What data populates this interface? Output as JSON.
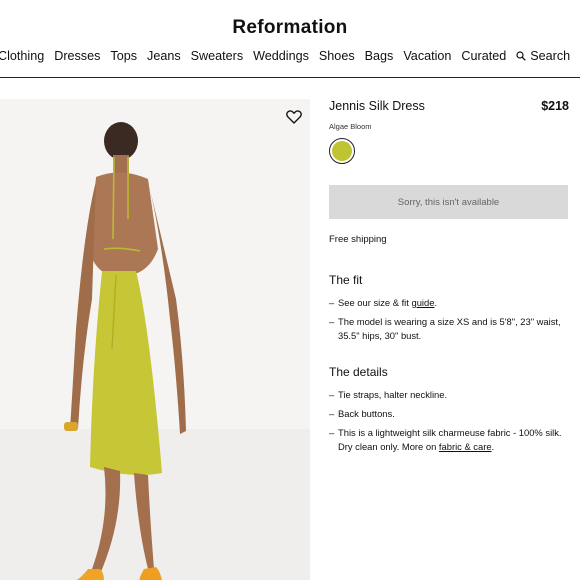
{
  "header": {
    "logo": "Reformation",
    "nav": [
      "Clothing",
      "Dresses",
      "Tops",
      "Jeans",
      "Sweaters",
      "Weddings",
      "Shoes",
      "Bags",
      "Vacation",
      "Curated"
    ],
    "search_label": "Search"
  },
  "product": {
    "name": "Jennis Silk Dress",
    "price": "$218",
    "color_name": "Algae Bloom",
    "swatch_color": "#c0c332",
    "availability_label": "Sorry, this isn't available",
    "shipping": "Free shipping"
  },
  "fit": {
    "title": "The fit",
    "item1_prefix": "See our size & fit ",
    "item1_link": "guide",
    "item1_suffix": ".",
    "item2": "The model is wearing a size XS and is 5'8\", 23\" waist, 35.5\" hips, 30\" bust."
  },
  "details": {
    "title": "The details",
    "item1": "Tie straps, halter neckline.",
    "item2": "Back buttons.",
    "item3_prefix": "This is a lightweight silk charmeuse fabric - 100% silk. Dry clean only. More on ",
    "item3_link": "fabric & care",
    "item3_suffix": "."
  },
  "icons": {
    "wishlist": "heart-icon",
    "search": "search-icon"
  }
}
